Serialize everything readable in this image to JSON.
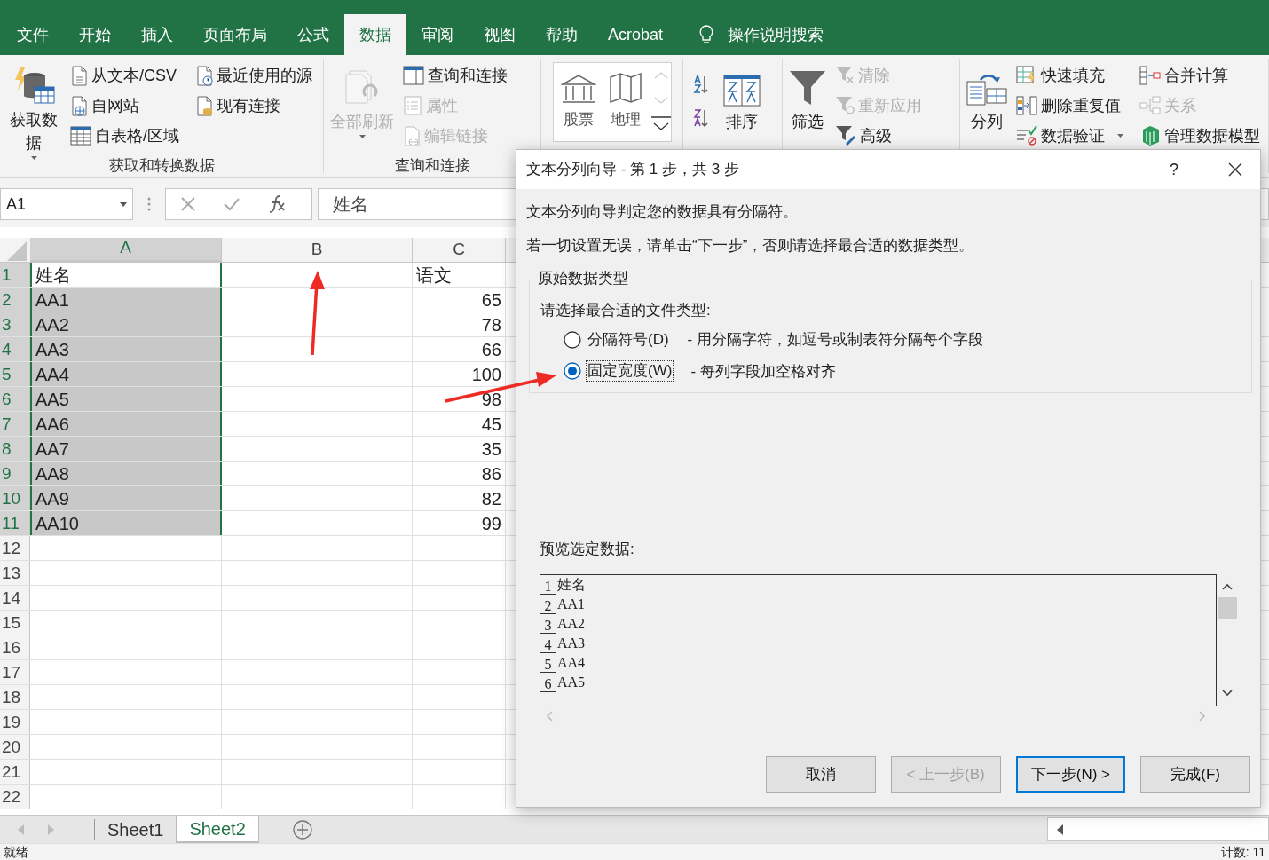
{
  "menu_tabs": [
    {
      "label": "文件",
      "selected": false
    },
    {
      "label": "开始",
      "selected": false
    },
    {
      "label": "插入",
      "selected": false
    },
    {
      "label": "页面布局",
      "selected": false
    },
    {
      "label": "公式",
      "selected": false
    },
    {
      "label": "数据",
      "selected": true
    },
    {
      "label": "审阅",
      "selected": false
    },
    {
      "label": "视图",
      "selected": false
    },
    {
      "label": "帮助",
      "selected": false
    },
    {
      "label": "Acrobat",
      "selected": false
    }
  ],
  "search": {
    "label": "操作说明搜索"
  },
  "ribbon": {
    "groups": [
      {
        "label": "获取和转换数据",
        "items": [
          {
            "label": "获取数据",
            "kind": "large",
            "disabled": false,
            "dropdown": true
          },
          {
            "label": "从文本/CSV",
            "kind": "small",
            "disabled": false
          },
          {
            "label": "自网站",
            "kind": "small",
            "disabled": false
          },
          {
            "label": "自表格/区域",
            "kind": "small",
            "disabled": false
          },
          {
            "label": "最近使用的源",
            "kind": "small",
            "disabled": false
          },
          {
            "label": "现有连接",
            "kind": "small",
            "disabled": false
          }
        ]
      },
      {
        "label": "查询和连接",
        "items": [
          {
            "label": "全部刷新",
            "kind": "large",
            "disabled": true,
            "dropdown": true
          },
          {
            "label": "查询和连接",
            "kind": "small",
            "disabled": false
          },
          {
            "label": "属性",
            "kind": "small",
            "disabled": true
          },
          {
            "label": "编辑链接",
            "kind": "small",
            "disabled": true
          }
        ]
      },
      {
        "items": [
          {
            "label": "股票",
            "kind": "gallery",
            "disabled": false
          },
          {
            "label": "地理",
            "kind": "gallery",
            "disabled": false
          }
        ]
      },
      {
        "items": [
          {
            "kind": "icon",
            "disabled": false
          },
          {
            "kind": "icon",
            "disabled": false
          },
          {
            "label": "排序",
            "kind": "large",
            "disabled": false
          }
        ]
      },
      {
        "items": [
          {
            "label": "筛选",
            "kind": "large",
            "disabled": false
          },
          {
            "label": "清除",
            "kind": "small",
            "disabled": true
          },
          {
            "label": "重新应用",
            "kind": "small",
            "disabled": true
          },
          {
            "label": "高级",
            "kind": "small",
            "disabled": false
          }
        ]
      },
      {
        "items": [
          {
            "label": "分列",
            "kind": "large",
            "disabled": false
          },
          {
            "label": "快速填充",
            "kind": "small",
            "disabled": false
          },
          {
            "label": "删除重复值",
            "kind": "small",
            "disabled": false
          },
          {
            "label": "数据验证",
            "kind": "small",
            "disabled": false,
            "dropdown": true
          },
          {
            "label": "合并计算",
            "kind": "small",
            "disabled": false
          },
          {
            "label": "关系",
            "kind": "small",
            "disabled": true
          },
          {
            "label": "管理数据模型",
            "kind": "small",
            "disabled": false
          }
        ]
      }
    ]
  },
  "formula_bar": {
    "name_box": "A1",
    "formula": "姓名"
  },
  "sheet": {
    "columns": [
      {
        "label": "A",
        "selected": true
      },
      {
        "label": "B",
        "selected": false
      },
      {
        "label": "C",
        "selected": false
      }
    ],
    "rows": [
      {
        "header": "1",
        "kind": "header",
        "selected": true,
        "active": true,
        "cells": [
          "姓名",
          "",
          "语文"
        ]
      },
      {
        "header": "2",
        "kind": "data",
        "selected": true,
        "cells": [
          "AA1",
          "",
          "65"
        ]
      },
      {
        "header": "3",
        "kind": "data",
        "selected": true,
        "cells": [
          "AA2",
          "",
          "78"
        ]
      },
      {
        "header": "4",
        "kind": "data",
        "selected": true,
        "cells": [
          "AA3",
          "",
          "66"
        ]
      },
      {
        "header": "5",
        "kind": "data",
        "selected": true,
        "cells": [
          "AA4",
          "",
          "100"
        ]
      },
      {
        "header": "6",
        "kind": "data",
        "selected": true,
        "cells": [
          "AA5",
          "",
          "98"
        ]
      },
      {
        "header": "7",
        "kind": "data",
        "selected": true,
        "cells": [
          "AA6",
          "",
          "45"
        ]
      },
      {
        "header": "8",
        "kind": "data",
        "selected": true,
        "cells": [
          "AA7",
          "",
          "35"
        ]
      },
      {
        "header": "9",
        "kind": "data",
        "selected": true,
        "cells": [
          "AA8",
          "",
          "86"
        ]
      },
      {
        "header": "10",
        "kind": "data",
        "selected": true,
        "cells": [
          "AA9",
          "",
          "82"
        ]
      },
      {
        "header": "11",
        "kind": "data",
        "selected": true,
        "cells": [
          "AA10",
          "",
          "99"
        ]
      },
      {
        "header": "12",
        "kind": "data",
        "selected": false,
        "cells": []
      },
      {
        "header": "13",
        "kind": "data",
        "selected": false,
        "cells": []
      },
      {
        "header": "14",
        "kind": "data",
        "selected": false,
        "cells": []
      },
      {
        "header": "15",
        "kind": "data",
        "selected": false,
        "cells": []
      },
      {
        "header": "16",
        "kind": "data",
        "selected": false,
        "cells": []
      },
      {
        "header": "17",
        "kind": "data",
        "selected": false,
        "cells": []
      },
      {
        "header": "18",
        "kind": "data",
        "selected": false,
        "cells": []
      },
      {
        "header": "19",
        "kind": "data",
        "selected": false,
        "cells": []
      },
      {
        "header": "20",
        "kind": "data",
        "selected": false,
        "cells": []
      },
      {
        "header": "21",
        "kind": "data",
        "selected": false,
        "cells": []
      },
      {
        "header": "22",
        "kind": "data",
        "selected": false,
        "cells": []
      }
    ]
  },
  "sheet_tabs": [
    {
      "label": "Sheet1",
      "selected": false
    },
    {
      "label": "Sheet2",
      "selected": true
    }
  ],
  "status_bar": {
    "left": "就绪",
    "right": "计数: 11"
  },
  "dialog": {
    "title": "文本分列向导 - 第 1 步，共 3 步",
    "help": "?",
    "intro": "文本分列向导判定您的数据具有分隔符。",
    "instruction": "若一切设置无误，请单击“下一步”，否则请选择最合适的数据类型。",
    "group": {
      "title": "原始数据类型",
      "prompt": "请选择最合适的文件类型:",
      "options": [
        {
          "label": "分隔符号(D)",
          "description": "- 用分隔字符，如逗号或制表符分隔每个字段",
          "selected": false
        },
        {
          "label": "固定宽度(W)",
          "description": "- 每列字段加空格对齐",
          "selected": true
        }
      ]
    },
    "preview": {
      "label": "预览选定数据:",
      "rows": [
        {
          "number": "1",
          "text": "姓名"
        },
        {
          "number": "2",
          "text": "AA1"
        },
        {
          "number": "3",
          "text": "AA2"
        },
        {
          "number": "4",
          "text": "AA3"
        },
        {
          "number": "5",
          "text": "AA4"
        },
        {
          "number": "6",
          "text": "AA5"
        }
      ]
    },
    "buttons": [
      {
        "label": "取消",
        "disabled": false,
        "focused": false
      },
      {
        "label": "< 上一步(B)",
        "disabled": true,
        "focused": false
      },
      {
        "label": "下一步(N) >",
        "disabled": false,
        "focused": true
      },
      {
        "label": "完成(F)",
        "disabled": false,
        "focused": false
      }
    ]
  }
}
